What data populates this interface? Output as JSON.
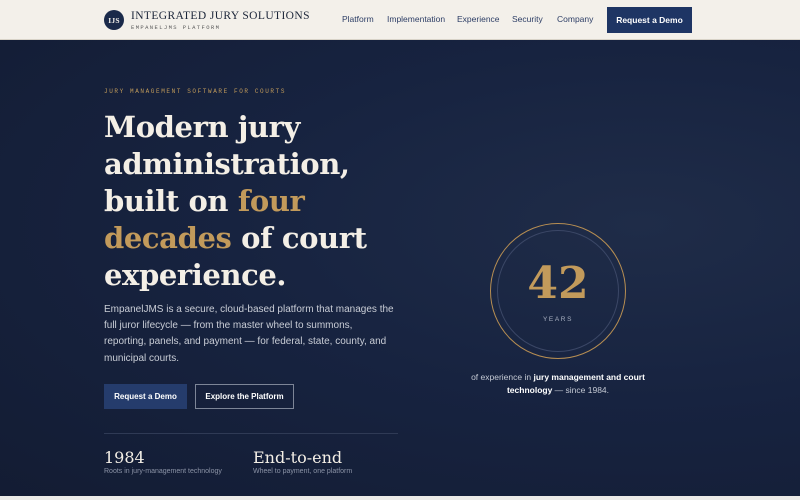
{
  "header": {
    "logo_initials": "IJS",
    "brand_name": "INTEGRATED JURY SOLUTIONS",
    "brand_tagline": "EMPANELJMS PLATFORM",
    "nav": [
      "Platform",
      "Implementation",
      "Experience",
      "Security",
      "Company"
    ],
    "cta_label": "Request a Demo"
  },
  "hero": {
    "eyebrow": "JURY MANAGEMENT SOFTWARE FOR COURTS",
    "headline": {
      "part1": "Modern jury administration, built on ",
      "highlight": "four decades",
      "part2": " of court experience."
    },
    "lead": "EmpanelJMS is a secure, cloud-based platform that manages the full juror lifecycle — from the master wheel to summons, reporting, panels, and payment — for federal, state, county, and municipal courts.",
    "primary_button": "Request a Demo",
    "secondary_button": "Explore the Platform",
    "stats": [
      {
        "value": "1984",
        "label": "Roots in jury-management technology"
      },
      {
        "value": "End-to-end",
        "label": "Wheel to payment, one platform"
      }
    ]
  },
  "badge": {
    "number": "42",
    "unit": "YEARS",
    "caption_pre": "of experience in ",
    "caption_bold": "jury management and court technology",
    "caption_post": " — since 1984."
  },
  "colors": {
    "navy": "#14203a",
    "gold": "#c29a5b",
    "header_bg": "#f3f0ea",
    "button": "#1e3564"
  }
}
